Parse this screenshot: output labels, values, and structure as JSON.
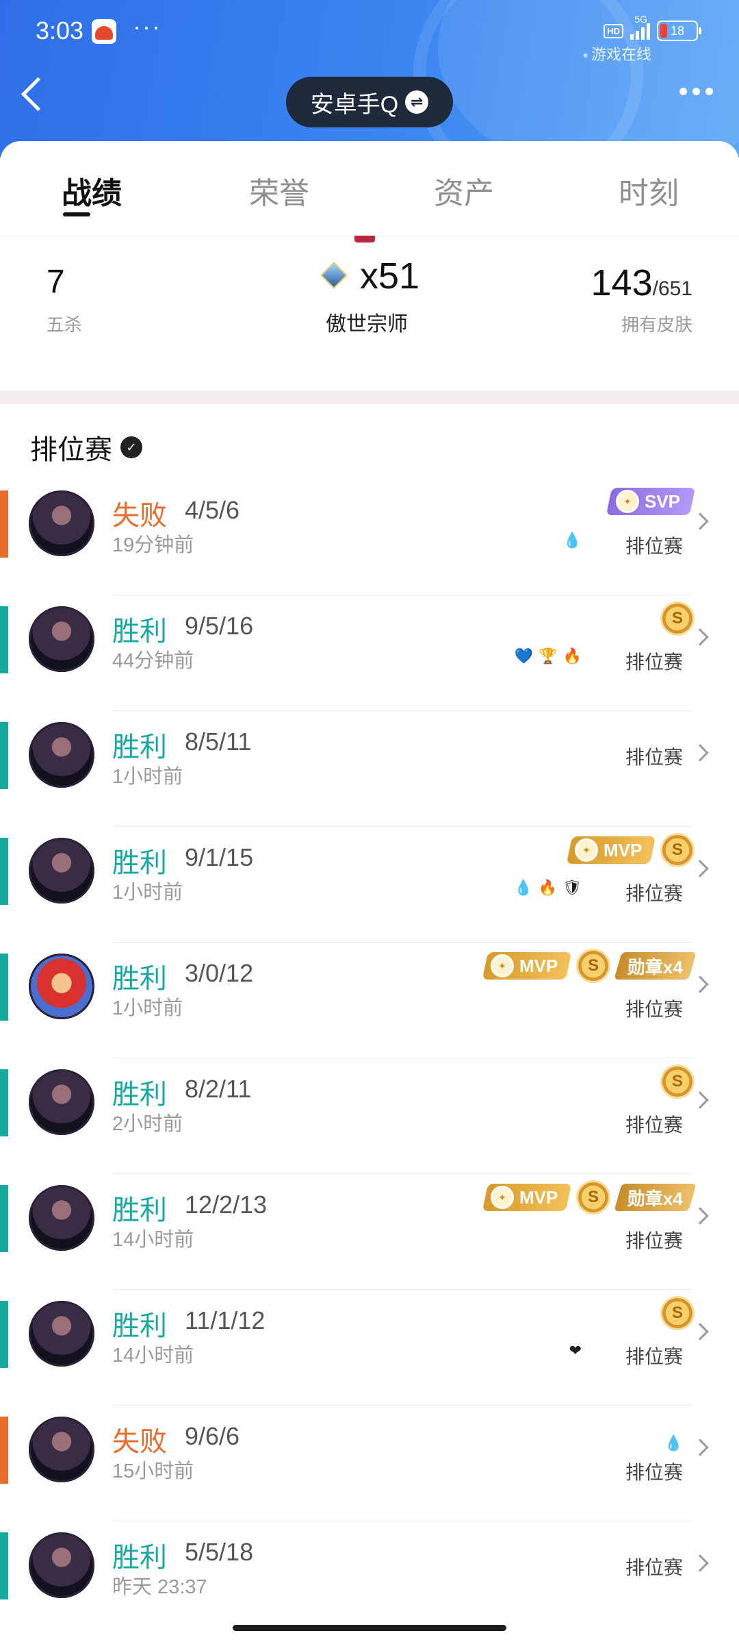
{
  "status_bar": {
    "time": "3:03",
    "dots": "···",
    "hd": "HD",
    "network": "5G",
    "battery": "18",
    "online_status": "游戏在线"
  },
  "header": {
    "account_label": "安卓手Q",
    "swap_glyph": "⇌"
  },
  "tabs": [
    {
      "label": "战绩",
      "active": true
    },
    {
      "label": "荣誉",
      "active": false
    },
    {
      "label": "资产",
      "active": false
    },
    {
      "label": "时刻",
      "active": false
    }
  ],
  "stats": {
    "pentakills": {
      "value": "7",
      "label": "五杀"
    },
    "rank": {
      "value": "x51",
      "label": "傲世宗师"
    },
    "skins": {
      "value": "143",
      "total": "/651",
      "label": "拥有皮肤"
    }
  },
  "section": {
    "title": "排位赛",
    "toggle_glyph": "✓"
  },
  "matches": [
    {
      "result": "失败",
      "outcome": "loss",
      "kda": "4/5/6",
      "time": "19分钟前",
      "mode": "排位赛",
      "badges": [
        "svp"
      ],
      "mini": [
        "💧"
      ]
    },
    {
      "result": "胜利",
      "outcome": "win",
      "kda": "9/5/16",
      "time": "44分钟前",
      "mode": "排位赛",
      "badges": [
        "coin"
      ],
      "mini": [
        "💙",
        "🏆",
        "🔥"
      ]
    },
    {
      "result": "胜利",
      "outcome": "win",
      "kda": "8/5/11",
      "time": "1小时前",
      "mode": "排位赛",
      "badges": [],
      "mini": []
    },
    {
      "result": "胜利",
      "outcome": "win",
      "kda": "9/1/15",
      "time": "1小时前",
      "mode": "排位赛",
      "badges": [
        "mvp",
        "coin"
      ],
      "mini": [
        "💧",
        "🔥",
        "🛡"
      ]
    },
    {
      "result": "胜利",
      "outcome": "win",
      "kda": "3/0/12",
      "time": "1小时前",
      "mode": "排位赛",
      "badges": [
        "mvp",
        "coin",
        "medal"
      ],
      "medal_text": "勋章x4",
      "mini": []
    },
    {
      "result": "胜利",
      "outcome": "win",
      "kda": "8/2/11",
      "time": "2小时前",
      "mode": "排位赛",
      "badges": [
        "coin"
      ],
      "mini": []
    },
    {
      "result": "胜利",
      "outcome": "win",
      "kda": "12/2/13",
      "time": "14小时前",
      "mode": "排位赛",
      "badges": [
        "mvp",
        "coin",
        "medal"
      ],
      "medal_text": "勋章x4",
      "mini": []
    },
    {
      "result": "胜利",
      "outcome": "win",
      "kda": "11/1/12",
      "time": "14小时前",
      "mode": "排位赛",
      "badges": [
        "coin"
      ],
      "mini": [
        "❤"
      ]
    },
    {
      "result": "失败",
      "outcome": "loss",
      "kda": "9/6/6",
      "time": "15小时前",
      "mode": "排位赛",
      "badges": [],
      "mini": [
        "💧"
      ]
    },
    {
      "result": "胜利",
      "outcome": "win",
      "kda": "5/5/18",
      "time": "昨天 23:37",
      "mode": "排位赛",
      "badges": [],
      "mini": []
    }
  ],
  "badge_text": {
    "svp": "SVP",
    "mvp": "MVP",
    "coin": "S"
  },
  "colors": {
    "win": "#17a8a0",
    "loss": "#e86d2b",
    "header": "#2f6ee8"
  }
}
